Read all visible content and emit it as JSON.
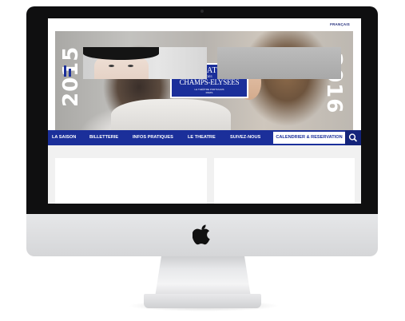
{
  "site": {
    "language": "FRANÇAIS",
    "logo": {
      "line1": "THEATRE",
      "line2": "DES",
      "line3": "CHAMPS-ELYSEES",
      "line4": "LE THÉÂTRE PORTUGAIS",
      "line5": "PARIS"
    },
    "season_start": "2015",
    "season_end": "2016"
  },
  "nav": {
    "items": [
      {
        "label": "LA SAISON"
      },
      {
        "label": "BILLETTERIE"
      },
      {
        "label": "INFOS PRATIQUES"
      },
      {
        "label": "LE THEATRE"
      },
      {
        "label": "SUIVEZ-NOUS"
      }
    ],
    "calendar_label": "CALENDRIER & RESERVATION",
    "search_icon": "search-icon"
  },
  "device": {
    "logo_icon": "apple-logo-icon"
  },
  "colors": {
    "brand_blue": "#1b2f9a",
    "nav_text": "#ffffff"
  }
}
